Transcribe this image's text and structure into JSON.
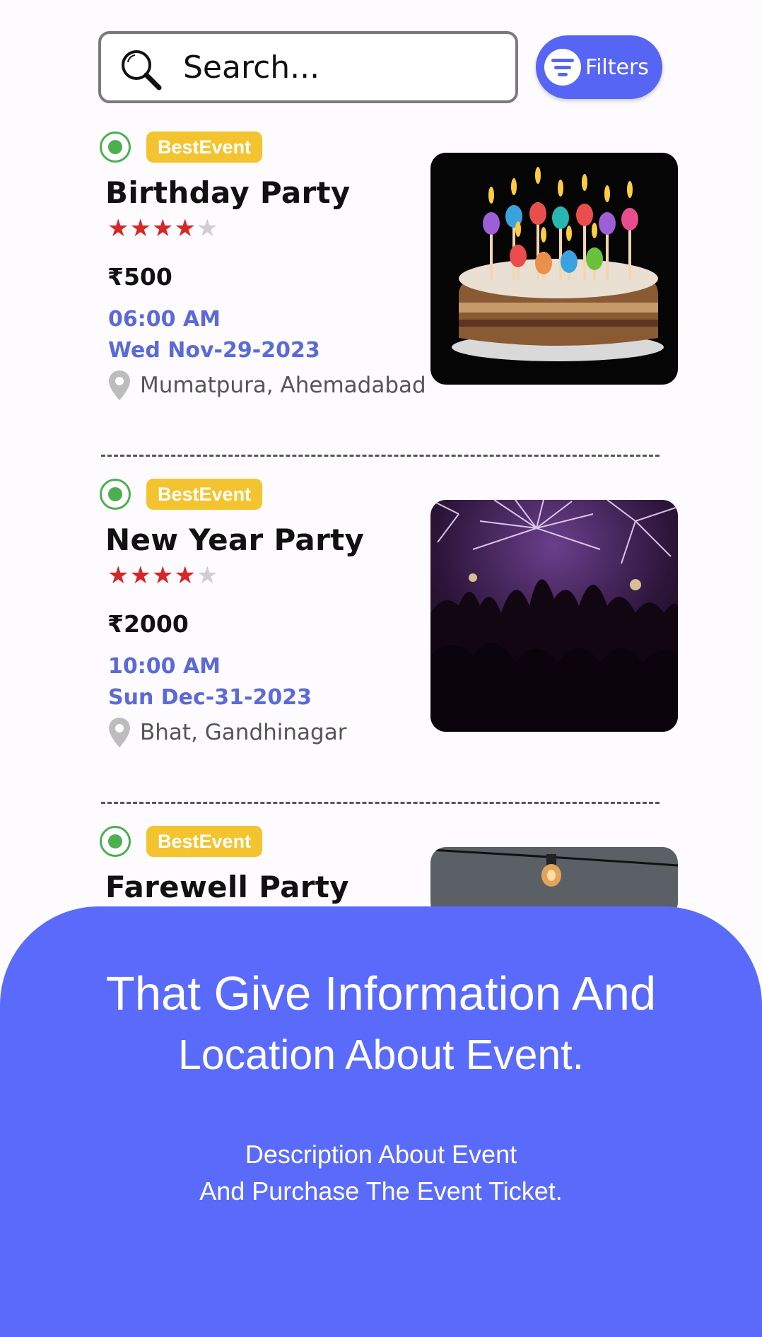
{
  "search": {
    "placeholder": "Search...",
    "filters_label": "Filters"
  },
  "events": [
    {
      "badge": "BestEvent",
      "title": "Birthday Party",
      "rating": 4,
      "rating_max": 5,
      "price": "₹500",
      "time": "06:00 AM",
      "date": "Wed Nov-29-2023",
      "location": "Mumatpura, Ahemadabad"
    },
    {
      "badge": "BestEvent",
      "title": "New Year Party",
      "rating": 4,
      "rating_max": 5,
      "price": "₹2000",
      "time": "10:00 AM",
      "date": "Sun Dec-31-2023",
      "location": "Bhat, Gandhinagar"
    },
    {
      "badge": "BestEvent",
      "title": "Farewell Party"
    }
  ],
  "panel": {
    "headline_line1": "That Give Information And",
    "headline_line2": "Location About Event.",
    "desc_line1": "Description About Event",
    "desc_line2": "And Purchase The Event Ticket."
  },
  "colors": {
    "accent": "#5a6bfc",
    "badge": "#f4c430",
    "status_green": "#4caf50",
    "star": "#d62727",
    "datetime": "#5b6ad8"
  }
}
